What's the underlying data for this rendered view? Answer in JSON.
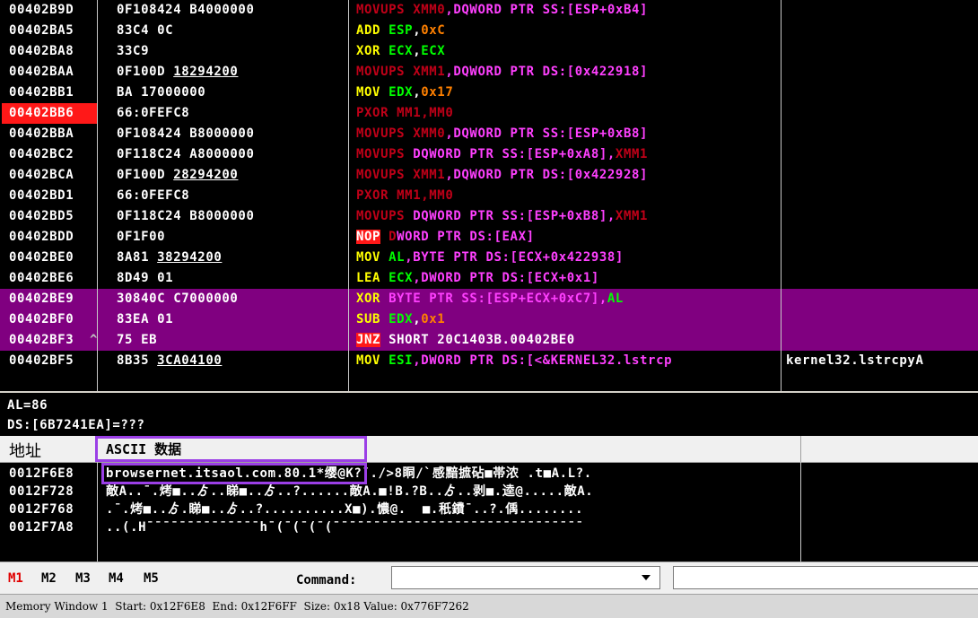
{
  "disasm": {
    "rows": [
      {
        "addr": "00402B9D",
        "hex": [
          [
            "0F108424 B4000000",
            ""
          ]
        ],
        "ins": [
          [
            "MOVUPS ",
            "dr"
          ],
          [
            "XMM0",
            "dr"
          ],
          [
            ",DQWORD PTR SS:[ESP+0xB4]",
            "m"
          ]
        ],
        "hl": false,
        "bp": false,
        "jmark": ""
      },
      {
        "addr": "00402BA5",
        "hex": [
          [
            "83C4 0C",
            ""
          ]
        ],
        "ins": [
          [
            "ADD ",
            "y"
          ],
          [
            "ESP",
            "g"
          ],
          [
            ",",
            "w"
          ],
          [
            "0xC",
            "o"
          ]
        ],
        "hl": false,
        "bp": false,
        "jmark": ""
      },
      {
        "addr": "00402BA8",
        "hex": [
          [
            "33C9",
            ""
          ]
        ],
        "ins": [
          [
            "XOR ",
            "y"
          ],
          [
            "ECX",
            "g"
          ],
          [
            ",",
            "w"
          ],
          [
            "ECX",
            "g"
          ]
        ],
        "hl": false,
        "bp": false,
        "jmark": ""
      },
      {
        "addr": "00402BAA",
        "hex": [
          [
            "0F100D ",
            ""
          ],
          [
            "18294200",
            "u"
          ]
        ],
        "ins": [
          [
            "MOVUPS ",
            "dr"
          ],
          [
            "XMM1",
            "dr"
          ],
          [
            ",DQWORD PTR DS:[0x422918]",
            "m"
          ]
        ],
        "hl": false,
        "bp": false,
        "jmark": ""
      },
      {
        "addr": "00402BB1",
        "hex": [
          [
            "BA 17000000",
            ""
          ]
        ],
        "ins": [
          [
            "MOV ",
            "y"
          ],
          [
            "EDX",
            "g"
          ],
          [
            ",",
            "w"
          ],
          [
            "0x17",
            "o"
          ]
        ],
        "hl": false,
        "bp": false,
        "jmark": ""
      },
      {
        "addr": "00402BB6",
        "hex": [
          [
            "66:0FEFC8",
            ""
          ]
        ],
        "ins": [
          [
            "PXOR ",
            "dr"
          ],
          [
            "MM1",
            "dr"
          ],
          [
            ",",
            "dr"
          ],
          [
            "MM0",
            "dr"
          ]
        ],
        "hl": false,
        "bp": true,
        "jmark": ""
      },
      {
        "addr": "00402BBA",
        "hex": [
          [
            "0F108424 B8000000",
            ""
          ]
        ],
        "ins": [
          [
            "MOVUPS ",
            "dr"
          ],
          [
            "XMM0",
            "dr"
          ],
          [
            ",DQWORD PTR SS:[ESP+0xB8]",
            "m"
          ]
        ],
        "hl": false,
        "bp": false,
        "jmark": ""
      },
      {
        "addr": "00402BC2",
        "hex": [
          [
            "0F118C24 A8000000",
            ""
          ]
        ],
        "ins": [
          [
            "MOVUPS ",
            "dr"
          ],
          [
            "DQWORD PTR SS:[ESP+0xA8],",
            "m"
          ],
          [
            "XMM1",
            "dr"
          ]
        ],
        "hl": false,
        "bp": false,
        "jmark": ""
      },
      {
        "addr": "00402BCA",
        "hex": [
          [
            "0F100D ",
            ""
          ],
          [
            "28294200",
            "u"
          ]
        ],
        "ins": [
          [
            "MOVUPS ",
            "dr"
          ],
          [
            "XMM1",
            "dr"
          ],
          [
            ",DQWORD PTR DS:[0x422928]",
            "m"
          ]
        ],
        "hl": false,
        "bp": false,
        "jmark": ""
      },
      {
        "addr": "00402BD1",
        "hex": [
          [
            "66:0FEFC8",
            ""
          ]
        ],
        "ins": [
          [
            "PXOR ",
            "dr"
          ],
          [
            "MM1",
            "dr"
          ],
          [
            ",",
            "dr"
          ],
          [
            "MM0",
            "dr"
          ]
        ],
        "hl": false,
        "bp": false,
        "jmark": ""
      },
      {
        "addr": "00402BD5",
        "hex": [
          [
            "0F118C24 B8000000",
            ""
          ]
        ],
        "ins": [
          [
            "MOVUPS ",
            "dr"
          ],
          [
            "DQWORD PTR SS:[ESP+0xB8],",
            "m"
          ],
          [
            "XMM1",
            "dr"
          ]
        ],
        "hl": false,
        "bp": false,
        "jmark": ""
      },
      {
        "addr": "00402BDD",
        "hex": [
          [
            "0F1F00",
            ""
          ]
        ],
        "ins": [
          [
            "NOP",
            "bad"
          ],
          [
            " D",
            "dr"
          ],
          [
            "WORD PTR DS:[EAX]",
            "m"
          ]
        ],
        "hl": false,
        "bp": false,
        "jmark": ""
      },
      {
        "addr": "00402BE0",
        "hex": [
          [
            "8A81 ",
            ""
          ],
          [
            "38294200",
            "u"
          ]
        ],
        "ins": [
          [
            "MOV ",
            "y"
          ],
          [
            "AL",
            "g"
          ],
          [
            ",BYTE PTR DS:[ECX+0x422938]",
            "m"
          ]
        ],
        "hl": false,
        "bp": false,
        "jmark": ""
      },
      {
        "addr": "00402BE6",
        "hex": [
          [
            "8D49 01",
            ""
          ]
        ],
        "ins": [
          [
            "LEA ",
            "y"
          ],
          [
            "ECX",
            "g"
          ],
          [
            ",DWORD PTR DS:[ECX+0x1]",
            "m"
          ]
        ],
        "hl": false,
        "bp": false,
        "jmark": ""
      },
      {
        "addr": "00402BE9",
        "hex": [
          [
            "30840C C7000000",
            ""
          ]
        ],
        "ins": [
          [
            "XOR ",
            "y"
          ],
          [
            "BYTE PTR SS:[ESP+ECX+0xC7],",
            "m"
          ],
          [
            "AL",
            "g"
          ]
        ],
        "hl": true,
        "bp": false,
        "jmark": ""
      },
      {
        "addr": "00402BF0",
        "hex": [
          [
            "83EA 01",
            ""
          ]
        ],
        "ins": [
          [
            "SUB ",
            "y"
          ],
          [
            "EDX",
            "g"
          ],
          [
            ",",
            "w"
          ],
          [
            "0x1",
            "o"
          ]
        ],
        "hl": true,
        "bp": false,
        "jmark": ""
      },
      {
        "addr": "00402BF3",
        "hex": [
          [
            "75 EB",
            ""
          ]
        ],
        "ins": [
          [
            "JNZ",
            "bad"
          ],
          [
            " SHORT 20C1403B.00402BE0",
            "w"
          ]
        ],
        "hl": true,
        "bp": false,
        "jmark": "^"
      },
      {
        "addr": "00402BF5",
        "hex": [
          [
            "8B35 ",
            ""
          ],
          [
            "3CA04100",
            "u"
          ]
        ],
        "ins": [
          [
            "MOV ",
            "y"
          ],
          [
            "ESI",
            "g"
          ],
          [
            ",DWORD PTR DS:[<&KERNEL32.lstrcp",
            "m"
          ]
        ],
        "hl": false,
        "bp": false,
        "jmark": "",
        "comment": "kernel32.lstrcpyA"
      }
    ]
  },
  "info": {
    "line1": "AL=86",
    "line2": "DS:[6B7241EA]=???"
  },
  "dump": {
    "col_address": "地址",
    "col_ascii": "ASCII 数据",
    "rows": [
      {
        "addr": "0012F6E8",
        "ascii": "browsernet.itsaol.com.80.1*缨@K?¯./>8眮/`঺感黯摭砧■帯浓 .t■A.L?."
      },
      {
        "addr": "0012F728",
        "ascii": "敵A..¯.烤■..ゟ..睇■..ゟ..?......敵A.■!B.?B..ゟ..剥■.逵@.....敵A."
      },
      {
        "addr": "0012F768",
        "ascii": ".¯.烤■..ゟ.睇■..ゟ..?..........X■).憹@.  ■.秖鐨¯..?.偊........"
      },
      {
        "addr": "0012F7A8",
        "ascii": "..(.H¯¯¯¯¯¯¯¯¯¯¯¯¯¯h¯(¯(¯(¯(¯¯¯¯¯¯¯¯¯¯¯¯¯¯¯¯¯¯¯¯¯¯¯¯¯¯¯¯¯¯¯"
      }
    ]
  },
  "cmdbar": {
    "tabs": [
      "M1",
      "M2",
      "M3",
      "M4",
      "M5"
    ],
    "active_tab": "M1",
    "command_label": "Command:",
    "command_value": ""
  },
  "status": {
    "text": "Memory Window 1  Start: 0x12F6E8  End: 0x12F6FF  Size: 0x18 Value: 0x776F7262"
  },
  "colors": {
    "bg": "#000000",
    "highlight": "#800080",
    "breakpoint": "#ff1818",
    "mnemonic": "#ffff00",
    "register": "#00ff00",
    "memory_operand": "#ff40ff",
    "immediate": "#ff8000",
    "highlight_box": "#9b3fe6"
  }
}
